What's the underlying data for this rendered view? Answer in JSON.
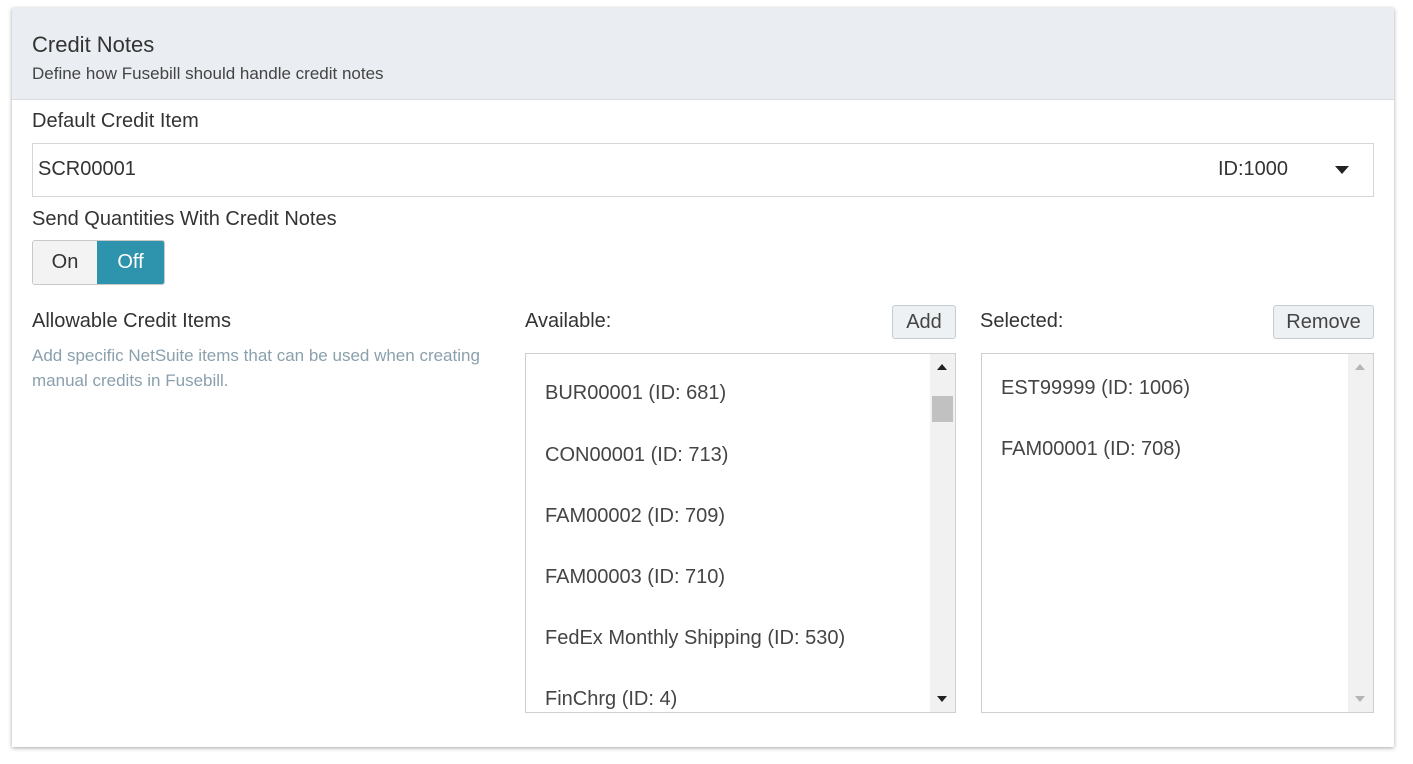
{
  "header": {
    "title": "Credit Notes",
    "subtitle": "Define how Fusebill should handle credit notes"
  },
  "default_credit_item": {
    "label": "Default Credit Item",
    "value": "SCR00001",
    "id_text": "ID:1000"
  },
  "send_quantities": {
    "label": "Send Quantities With Credit Notes",
    "on_label": "On",
    "off_label": "Off",
    "selected": "Off",
    "active_color": "#2e93ad"
  },
  "allowable": {
    "label": "Allowable Credit Items",
    "help": "Add specific NetSuite items that can be used when creating manual credits in Fusebill."
  },
  "available": {
    "label": "Available:",
    "button": "Add",
    "items": [
      "BUR00001 (ID: 681)",
      "CON00001 (ID: 713)",
      "FAM00002 (ID: 709)",
      "FAM00003 (ID: 710)",
      "FedEx Monthly Shipping (ID: 530)",
      "FinChrg (ID: 4)"
    ]
  },
  "selected": {
    "label": "Selected:",
    "button": "Remove",
    "items": [
      "EST99999 (ID: 1006)",
      "FAM00001 (ID: 708)"
    ]
  }
}
